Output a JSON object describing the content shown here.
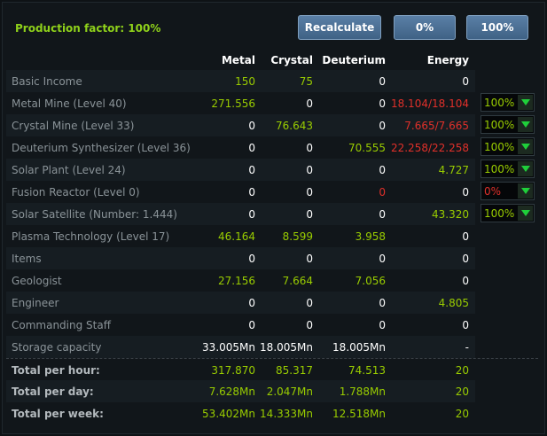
{
  "production_factor": "Production factor: 100%",
  "buttons": {
    "recalculate": "Recalculate",
    "zero": "0%",
    "hundred": "100%"
  },
  "columns": {
    "metal": "Metal",
    "crystal": "Crystal",
    "deuterium": "Deuterium",
    "energy": "Energy"
  },
  "rows": [
    {
      "name": "Basic Income",
      "metal": "150",
      "crystal": "75",
      "deuterium": "0",
      "energy": "0"
    },
    {
      "name": "Metal Mine (Level 40)",
      "metal": "271.556",
      "crystal": "0",
      "deuterium": "0",
      "energy": "18.104/18.104",
      "select": "100%"
    },
    {
      "name": "Crystal Mine (Level 33)",
      "metal": "0",
      "crystal": "76.643",
      "deuterium": "0",
      "energy": "7.665/7.665",
      "select": "100%"
    },
    {
      "name": "Deuterium Synthesizer (Level 36)",
      "metal": "0",
      "crystal": "0",
      "deuterium": "70.555",
      "energy": "22.258/22.258",
      "select": "100%"
    },
    {
      "name": "Solar Plant (Level 24)",
      "metal": "0",
      "crystal": "0",
      "deuterium": "0",
      "energy": "4.727",
      "select": "100%"
    },
    {
      "name": "Fusion Reactor (Level 0)",
      "metal": "0",
      "crystal": "0",
      "deuterium": "0",
      "energy": "0",
      "select": "0%"
    },
    {
      "name": "Solar Satellite (Number: 1.444)",
      "metal": "0",
      "crystal": "0",
      "deuterium": "0",
      "energy": "43.320",
      "select": "100%"
    },
    {
      "name": "Plasma Technology (Level 17)",
      "metal": "46.164",
      "crystal": "8.599",
      "deuterium": "3.958",
      "energy": "0"
    },
    {
      "name": "Items",
      "metal": "0",
      "crystal": "0",
      "deuterium": "0",
      "energy": "0"
    },
    {
      "name": "Geologist",
      "metal": "27.156",
      "crystal": "7.664",
      "deuterium": "7.056",
      "energy": "0"
    },
    {
      "name": "Engineer",
      "metal": "0",
      "crystal": "0",
      "deuterium": "0",
      "energy": "4.805"
    },
    {
      "name": "Commanding Staff",
      "metal": "0",
      "crystal": "0",
      "deuterium": "0",
      "energy": "0"
    },
    {
      "name": "Storage capacity",
      "metal": "33.005Mn",
      "crystal": "18.005Mn",
      "deuterium": "18.005Mn",
      "energy": "-"
    }
  ],
  "totals": [
    {
      "name": "Total per hour:",
      "metal": "317.870",
      "crystal": "85.317",
      "deuterium": "74.513",
      "energy": "20"
    },
    {
      "name": "Total per day:",
      "metal": "7.628Mn",
      "crystal": "2.047Mn",
      "deuterium": "1.788Mn",
      "energy": "20"
    },
    {
      "name": "Total per week:",
      "metal": "53.402Mn",
      "crystal": "14.333Mn",
      "deuterium": "12.518Mn",
      "energy": "20"
    }
  ],
  "colors": {
    "green": "#99cc00",
    "red": "#e0302a",
    "white": "#ffffff",
    "select_green": "#1fcf3a"
  }
}
